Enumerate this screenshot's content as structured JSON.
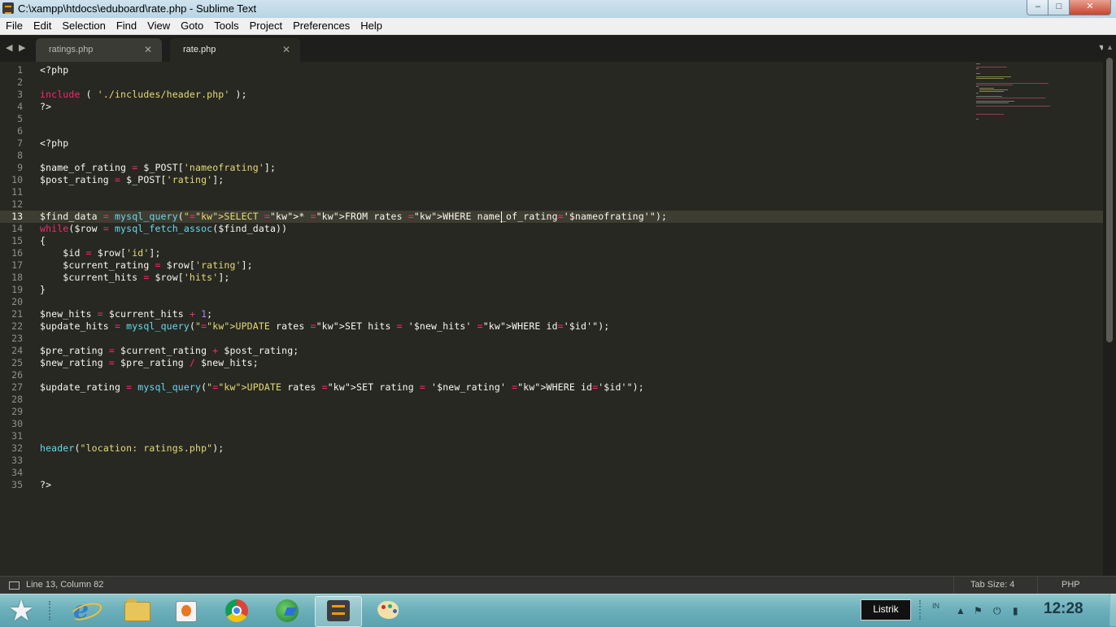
{
  "window": {
    "title": "C:\\xampp\\htdocs\\eduboard\\rate.php - Sublime Text",
    "controls": {
      "minimize": "–",
      "maximize": "□",
      "close": "✕"
    }
  },
  "menu": [
    "File",
    "Edit",
    "Selection",
    "Find",
    "View",
    "Goto",
    "Tools",
    "Project",
    "Preferences",
    "Help"
  ],
  "tabs": [
    {
      "label": "ratings.php",
      "active": false
    },
    {
      "label": "rate.php",
      "active": true
    }
  ],
  "glyphs": {
    "nav_back": "◀",
    "nav_forward": "▶",
    "close": "✕",
    "dropdown": "▼",
    "scroll_up": "▲"
  },
  "editor": {
    "current_line": 13,
    "lines": [
      "<?php",
      "",
      "include ( './includes/header.php' );",
      "?>",
      "",
      "",
      "<?php",
      "",
      "$name_of_rating = $_POST['nameofrating'];",
      "$post_rating = $_POST['rating'];",
      "",
      "",
      "$find_data = mysql_query(\"SELECT * FROM rates WHERE name_of_rating='$nameofrating'\");",
      "while($row = mysql_fetch_assoc($find_data))",
      "{",
      "    $id = $row['id'];",
      "    $current_rating = $row['rating'];",
      "    $current_hits = $row['hits'];",
      "}",
      "",
      "$new_hits = $current_hits + 1;",
      "$update_hits = mysql_query(\"UPDATE rates SET hits = '$new_hits' WHERE id='$id'\");",
      "",
      "$pre_rating = $current_rating + $post_rating;",
      "$new_rating = $pre_rating / $new_hits;",
      "",
      "$update_rating = mysql_query(\"UPDATE rates SET rating = '$new_rating' WHERE id='$id'\");",
      "",
      "",
      "",
      "",
      "header(\"location: ratings.php\");",
      "",
      "",
      "?>"
    ]
  },
  "statusbar": {
    "position": "Line 13, Column 82",
    "tab_size": "Tab Size: 4",
    "syntax": "PHP"
  },
  "taskbar": {
    "pinned": [
      "start-button",
      "internet-explorer",
      "file-explorer",
      "media-player",
      "chrome",
      "globe-app",
      "sublime-text",
      "paint"
    ],
    "tooltip": "Listrik",
    "lang": "IN",
    "clock": "12:28"
  },
  "colors": {
    "editor_bg": "#272822",
    "keyword": "#f92672",
    "function": "#66d9ef",
    "string": "#e6db74",
    "number": "#ae81ff",
    "text": "#f8f8f2"
  }
}
